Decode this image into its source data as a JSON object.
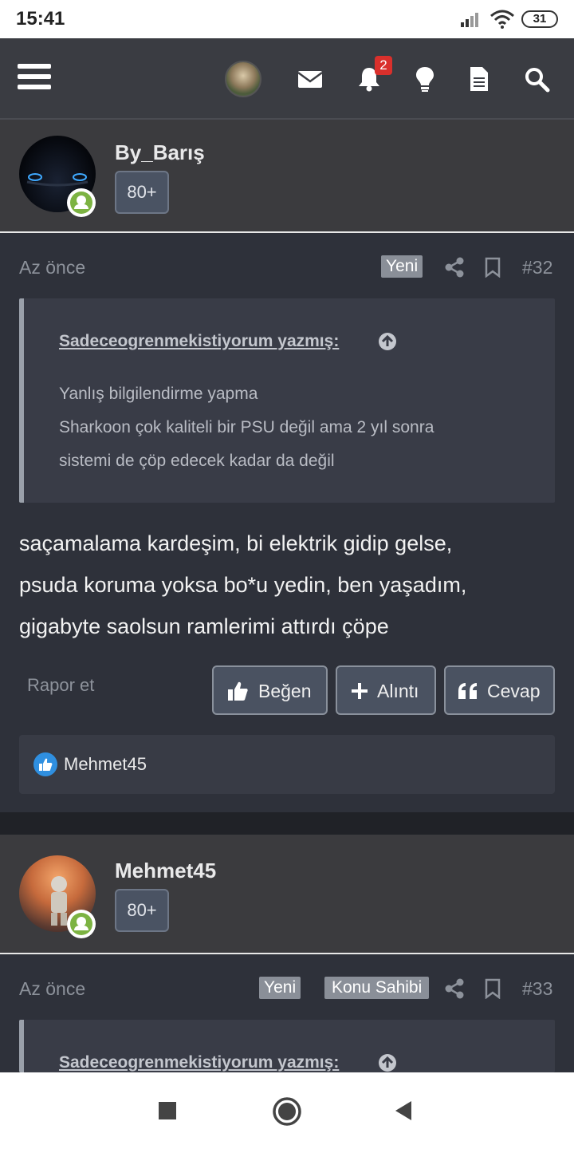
{
  "status_bar": {
    "time": "15:41",
    "battery": "31"
  },
  "nav": {
    "notification_count": "2",
    "icons": [
      "menu-icon",
      "avatar",
      "mail-icon",
      "bell-icon",
      "lightbulb-icon",
      "document-icon",
      "search-icon"
    ]
  },
  "posts": [
    {
      "username": "By_Barış",
      "user_badge": "80+",
      "time": "Az önce",
      "tags": [
        "Yeni"
      ],
      "post_number": "#32",
      "quote_author": "Sadeceogrenmekistiyorum yazmış:",
      "quote_lines": [
        "Yanlış bilgilendirme yapma",
        "Sharkoon çok kaliteli bir PSU değil ama 2 yıl sonra",
        "sistemi de çöp edecek kadar da değil"
      ],
      "text_lines": [
        "saçamalama kardeşim, bi elektrik gidip gelse,",
        "psuda koruma yoksa bo*u yedin, ben yaşadım,",
        "gigabyte saolsun ramlerimi attırdı çöpe"
      ],
      "report_label": "Rapor et",
      "like_label": "Beğen",
      "quote_label": "Alıntı",
      "reply_label": "Cevap",
      "liked_by": "Mehmet45"
    },
    {
      "username": "Mehmet45",
      "user_badge": "80+",
      "time": "Az önce",
      "tags": [
        "Yeni",
        "Konu Sahibi"
      ],
      "post_number": "#33",
      "quote_author": "Sadeceogrenmekistiyorum yazmış:"
    }
  ],
  "colors": {
    "accent_badge": "#d9302c",
    "online": "#7cb342",
    "like_blue": "#2f8fe0"
  }
}
